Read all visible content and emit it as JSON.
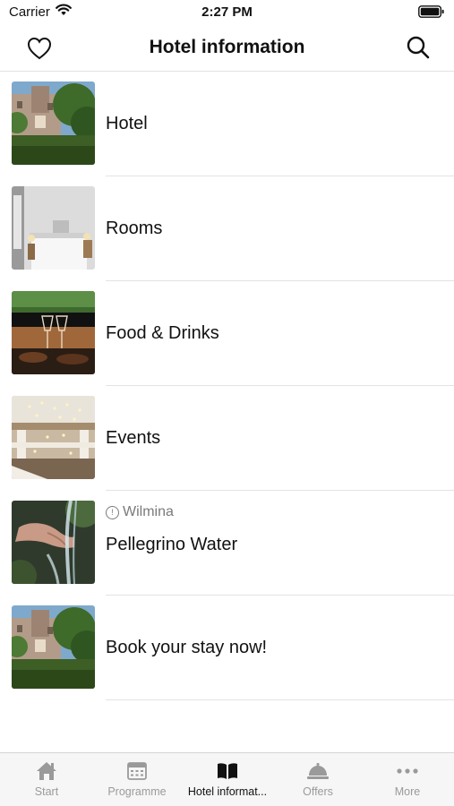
{
  "status_bar": {
    "carrier": "Carrier",
    "time": "2:27 PM"
  },
  "nav": {
    "title": "Hotel information"
  },
  "items": [
    {
      "title": "Hotel"
    },
    {
      "title": "Rooms"
    },
    {
      "title": "Food & Drinks"
    },
    {
      "title": "Events"
    },
    {
      "title": "Pellegrino Water",
      "subtitle": "Wilmina"
    },
    {
      "title": "Book your stay now!"
    }
  ],
  "tabs": [
    {
      "label": "Start",
      "icon": "home-icon"
    },
    {
      "label": "Programme",
      "icon": "calendar-icon"
    },
    {
      "label": "Hotel informat...",
      "icon": "book-icon",
      "active": true
    },
    {
      "label": "Offers",
      "icon": "service-bell-icon"
    },
    {
      "label": "More",
      "icon": "more-dots-icon"
    }
  ],
  "colors": {
    "text": "#111111",
    "muted": "#9a9a9a",
    "divider": "#e3e3e3",
    "tab_bg": "#f6f6f6"
  }
}
